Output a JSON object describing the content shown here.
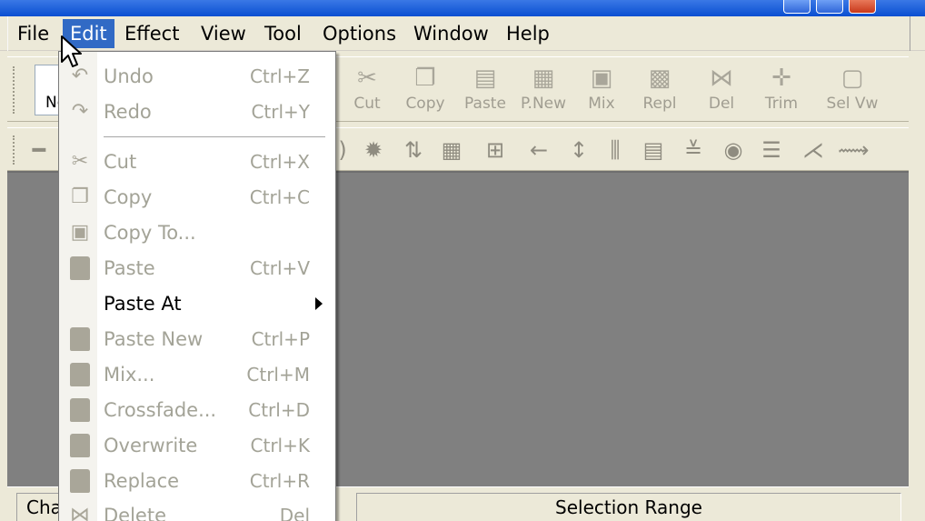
{
  "menubar": {
    "items": [
      {
        "label": "File"
      },
      {
        "label": "Edit"
      },
      {
        "label": "Effect"
      },
      {
        "label": "View"
      },
      {
        "label": "Tool"
      },
      {
        "label": "Options"
      },
      {
        "label": "Window"
      },
      {
        "label": "Help"
      }
    ]
  },
  "toolbar": {
    "new_label": "Ne",
    "buttons": [
      {
        "label": "Cut",
        "icon": "scissors-icon"
      },
      {
        "label": "Copy",
        "icon": "copy-icon"
      },
      {
        "label": "Paste",
        "icon": "paste-icon"
      },
      {
        "label": "P.New",
        "icon": "paste-new-icon"
      },
      {
        "label": "Mix",
        "icon": "mix-icon"
      },
      {
        "label": "Repl",
        "icon": "replace-icon"
      },
      {
        "label": "Del",
        "icon": "delete-icon"
      },
      {
        "label": "Trim",
        "icon": "trim-icon"
      },
      {
        "label": "Sel Vw",
        "icon": "select-view-icon"
      }
    ]
  },
  "edit_menu": {
    "items": [
      {
        "label": "Undo",
        "shortcut": "Ctrl+Z",
        "icon": "undo-icon"
      },
      {
        "label": "Redo",
        "shortcut": "Ctrl+Y",
        "icon": "redo-icon"
      },
      {
        "label": "Cut",
        "shortcut": "Ctrl+X",
        "icon": "scissors-icon"
      },
      {
        "label": "Copy",
        "shortcut": "Ctrl+C",
        "icon": "copy-icon"
      },
      {
        "label": "Copy To...",
        "shortcut": "",
        "icon": "copy-to-icon"
      },
      {
        "label": "Paste",
        "shortcut": "Ctrl+V",
        "icon": "paste-icon"
      },
      {
        "label": "Paste At",
        "shortcut": "",
        "icon": ""
      },
      {
        "label": "Paste New",
        "shortcut": "Ctrl+P",
        "icon": "paste-new-icon"
      },
      {
        "label": "Mix...",
        "shortcut": "Ctrl+M",
        "icon": "mix-icon"
      },
      {
        "label": "Crossfade...",
        "shortcut": "Ctrl+D",
        "icon": "crossfade-icon"
      },
      {
        "label": "Overwrite",
        "shortcut": "Ctrl+K",
        "icon": "overwrite-icon"
      },
      {
        "label": "Replace",
        "shortcut": "Ctrl+R",
        "icon": "replace-icon"
      },
      {
        "label": "Delete",
        "shortcut": "Del",
        "icon": "delete-icon"
      }
    ]
  },
  "statusbar": {
    "left_label": "Cha",
    "selection_label": "Selection Range"
  },
  "colors": {
    "menu_highlight": "#316ac5",
    "window_bg": "#ece9d8",
    "workspace_bg": "#808080",
    "disabled_text": "#a3a397"
  }
}
